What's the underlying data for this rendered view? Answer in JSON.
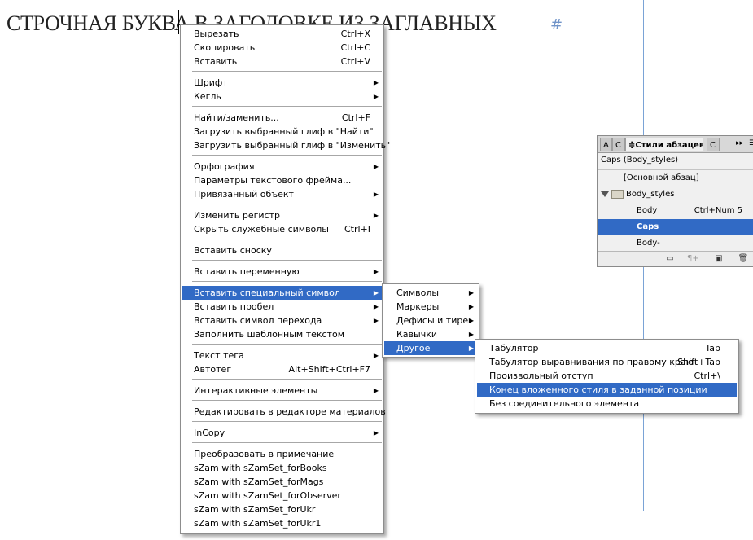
{
  "document": {
    "heading": "СТРОЧНАЯ БУКВА В ЗАГОЛОВКЕ ИЗ ЗАГЛАВНЫХ",
    "paragraph_mark": "#"
  },
  "main_menu": {
    "items": [
      {
        "label": "Вырезать",
        "shortcut": "Ctrl+X"
      },
      {
        "label": "Скопировать",
        "shortcut": "Ctrl+C"
      },
      {
        "label": "Вставить",
        "shortcut": "Ctrl+V"
      },
      {
        "label": "Шрифт",
        "submenu": true
      },
      {
        "label": "Кегль",
        "submenu": true
      },
      {
        "label": "Найти/заменить...",
        "shortcut": "Ctrl+F"
      },
      {
        "label": "Загрузить выбранный глиф в \"Найти\""
      },
      {
        "label": "Загрузить выбранный глиф в \"Изменить\""
      },
      {
        "label": "Орфография",
        "submenu": true
      },
      {
        "label": "Параметры текстового фрейма..."
      },
      {
        "label": "Привязанный объект",
        "submenu": true
      },
      {
        "label": "Изменить регистр",
        "submenu": true
      },
      {
        "label": "Скрыть служебные символы",
        "shortcut": "Ctrl+I"
      },
      {
        "label": "Вставить сноску"
      },
      {
        "label": "Вставить переменную",
        "submenu": true
      },
      {
        "label": "Вставить специальный символ",
        "submenu": true,
        "selected": true
      },
      {
        "label": "Вставить пробел",
        "submenu": true
      },
      {
        "label": "Вставить символ перехода",
        "submenu": true
      },
      {
        "label": "Заполнить шаблонным текстом"
      },
      {
        "label": "Текст тега",
        "submenu": true
      },
      {
        "label": "Автотег",
        "shortcut": "Alt+Shift+Ctrl+F7"
      },
      {
        "label": "Интерактивные элементы",
        "submenu": true
      },
      {
        "label": "Редактировать в редакторе материалов"
      },
      {
        "label": "InCopy",
        "submenu": true
      },
      {
        "label": "Преобразовать в примечание"
      },
      {
        "label": "sZam with sZamSet_forBooks"
      },
      {
        "label": "sZam with sZamSet_forMags"
      },
      {
        "label": "sZam with sZamSet_forObserver"
      },
      {
        "label": "sZam with sZamSet_forUkr"
      },
      {
        "label": "sZam with sZamSet_forUkr1"
      }
    ]
  },
  "special_char_menu": {
    "items": [
      {
        "label": "Символы",
        "submenu": true
      },
      {
        "label": "Маркеры",
        "submenu": true
      },
      {
        "label": "Дефисы и тире",
        "submenu": true
      },
      {
        "label": "Кавычки",
        "submenu": true
      },
      {
        "label": "Другое",
        "submenu": true,
        "selected": true
      }
    ]
  },
  "other_menu": {
    "items": [
      {
        "label": "Табулятор",
        "shortcut": "Tab"
      },
      {
        "label": "Табулятор выравнивания по правому краю",
        "shortcut": "Shift+Tab"
      },
      {
        "label": "Произвольный отступ",
        "shortcut": "Ctrl+\\"
      },
      {
        "label": "Конец вложенного стиля в заданной позиции",
        "selected": true
      },
      {
        "label": "Без соединительного элемента"
      }
    ]
  },
  "styles_panel": {
    "tabs": [
      "А",
      "С",
      "Стили абзацев",
      "С"
    ],
    "header": "Caps (Body_styles)",
    "rows": [
      {
        "label": "[Основной абзац]"
      },
      {
        "label": "Body_styles"
      },
      {
        "label": "Body",
        "shortcut": "Ctrl+Num 5"
      },
      {
        "label": "Caps",
        "selected": true
      },
      {
        "label": "Body-"
      }
    ],
    "menu_glyph": "▸▸",
    "buttons": [
      "folder-icon",
      "clear-overrides-icon",
      "new-style-icon",
      "trash-icon"
    ]
  },
  "colors": {
    "selection": "#316ac5",
    "guide": "#7aa3d6"
  }
}
